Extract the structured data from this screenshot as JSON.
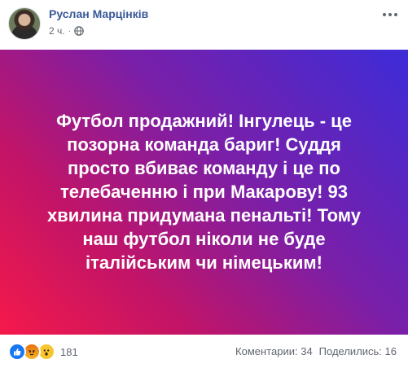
{
  "post": {
    "author": "Руслан Марцінків",
    "time": "2 ч.",
    "separator": "·",
    "text": "Футбол продажний! Інгулець - це\nпозорна команда бариг! Суддя\nпросто вбиває команду і це по\nтелебаченню і при Макарову! 93\nхвилина придумана пенальті! Тому\nнаш футбол ніколи не буде\nіталійським чи німецьким!",
    "background_gradient": [
      "#f5194a",
      "#c11468",
      "#7a1fa8",
      "#3d2cd8"
    ]
  },
  "icons": {
    "avatar": "avatar",
    "audience": "globe-icon",
    "menu": "more-options-icon",
    "reactions": [
      "like-reaction-icon",
      "angry-reaction-icon",
      "wow-reaction-icon"
    ]
  },
  "footer": {
    "reaction_count": "181",
    "comments": "Коментарии: 34",
    "shares": "Поделились: 16"
  },
  "colors": {
    "author": "#385898",
    "meta": "#606770",
    "like": "#1877f2"
  }
}
